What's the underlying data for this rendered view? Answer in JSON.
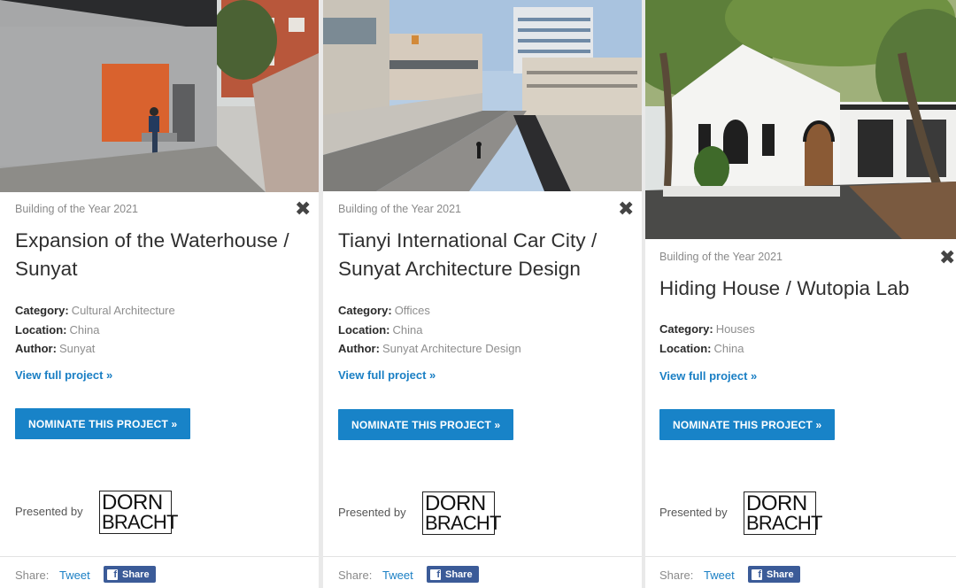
{
  "cards": [
    {
      "award": "Building of the Year 2021",
      "close_icon": "✖",
      "title": "Expansion of the Waterhouse / Sunyat",
      "meta": [
        {
          "key": "Category:",
          "value": "Cultural Architecture"
        },
        {
          "key": "Location:",
          "value": "China"
        },
        {
          "key": "Author:",
          "value": "Sunyat"
        }
      ],
      "view_link": "View full project »",
      "nominate_label": "NOMINATE THIS PROJECT »",
      "presented_label": "Presented by",
      "logo": {
        "line1": "DORN",
        "line2": "BRACHT"
      },
      "share": {
        "label": "Share:",
        "tweet": "Tweet",
        "fb_share": "Share"
      }
    },
    {
      "award": "Building of the Year 2021",
      "close_icon": "✖",
      "title": "Tianyi International Car City / Sunyat Architecture Design",
      "meta": [
        {
          "key": "Category:",
          "value": "Offices"
        },
        {
          "key": "Location:",
          "value": "China"
        },
        {
          "key": "Author:",
          "value": "Sunyat Architecture Design"
        }
      ],
      "view_link": "View full project »",
      "nominate_label": "NOMINATE THIS PROJECT »",
      "presented_label": "Presented by",
      "logo": {
        "line1": "DORN",
        "line2": "BRACHT"
      },
      "share": {
        "label": "Share:",
        "tweet": "Tweet",
        "fb_share": "Share"
      }
    },
    {
      "award": "Building of the Year 2021",
      "close_icon": "✖",
      "title": "Hiding House / Wutopia Lab",
      "meta": [
        {
          "key": "Category:",
          "value": "Houses"
        },
        {
          "key": "Location:",
          "value": "China"
        }
      ],
      "view_link": "View full project »",
      "nominate_label": "NOMINATE THIS PROJECT »",
      "presented_label": "Presented by",
      "logo": {
        "line1": "DORN",
        "line2": "BRACHT"
      },
      "share": {
        "label": "Share:",
        "tweet": "Tweet",
        "fb_share": "Share"
      }
    }
  ],
  "colors": {
    "accent": "#1883c8",
    "link": "#1a7fc4",
    "facebook": "#3b5b98"
  }
}
